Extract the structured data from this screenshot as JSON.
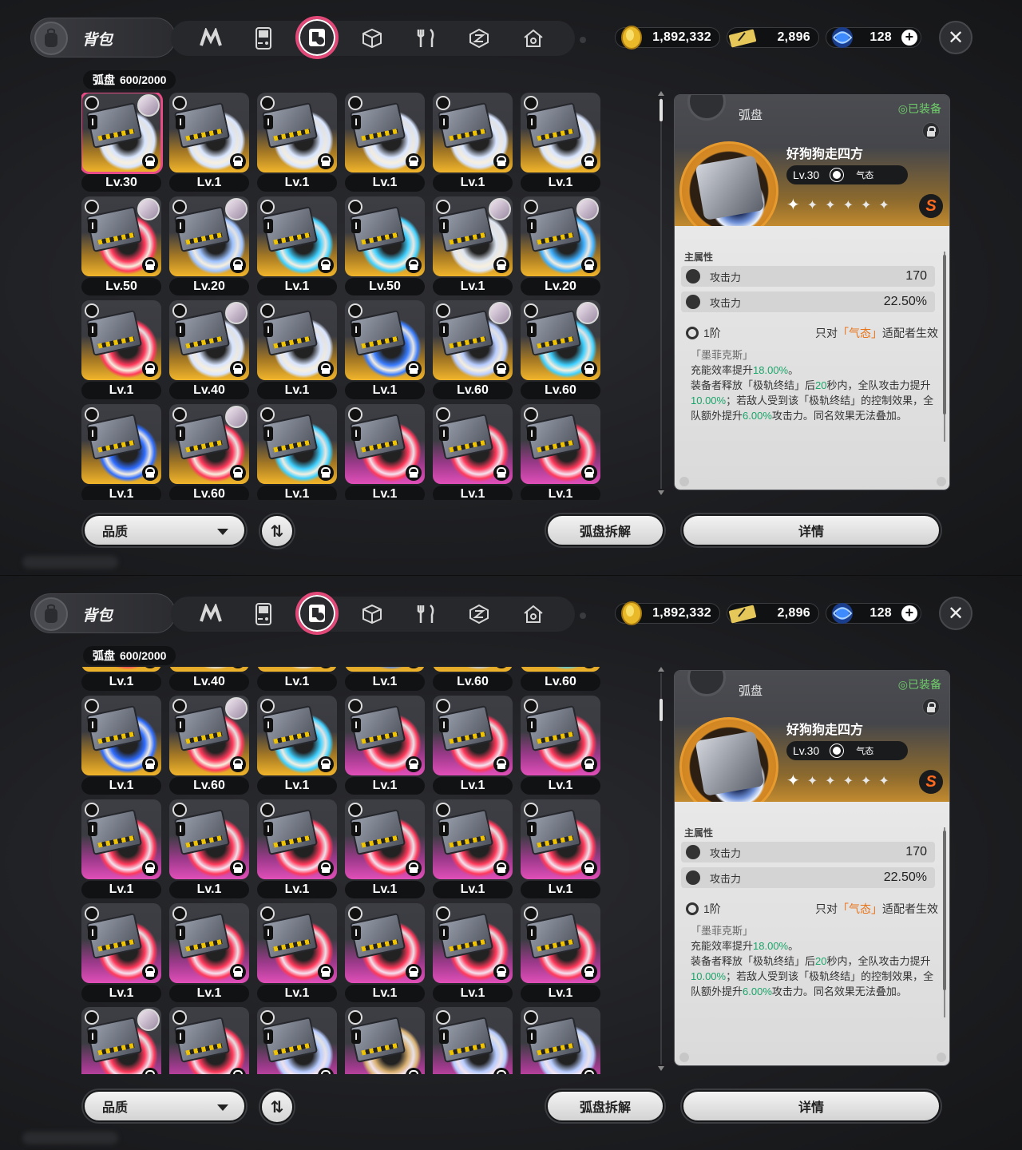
{
  "top": {
    "title": "背包",
    "tabs": [
      {
        "icon": "zenless-logo-icon"
      },
      {
        "icon": "gameboy-icon"
      },
      {
        "icon": "disc-book-icon",
        "active": true
      },
      {
        "icon": "cube-icon"
      },
      {
        "icon": "fork-knife-icon"
      },
      {
        "icon": "emblem-icon"
      },
      {
        "icon": "home-icon"
      }
    ],
    "currencies": [
      {
        "icon": "gold-coin-icon",
        "value": "1,892,332"
      },
      {
        "icon": "ticket-icon",
        "value": "2,896"
      },
      {
        "icon": "battery-icon",
        "value": "128"
      }
    ],
    "close_label": "✕"
  },
  "counter": {
    "label": "弧盘",
    "value": "600/2000"
  },
  "colors": {
    "accent": "#e74c86",
    "gold": "#f2b52b",
    "pink": "#e14fb8",
    "green": "#1ca56a",
    "orange": "#e8741a"
  },
  "panel1": {
    "items": [
      {
        "level": "Lv.30",
        "rarity": "gold",
        "avatar": true,
        "selected": true,
        "ring": "#d9e6ff"
      },
      {
        "level": "Lv.1",
        "rarity": "gold",
        "avatar": false,
        "ring": "#d9e6ff"
      },
      {
        "level": "Lv.1",
        "rarity": "gold",
        "avatar": false,
        "ring": "#d9e6ff"
      },
      {
        "level": "Lv.1",
        "rarity": "gold",
        "avatar": false,
        "ring": "#d9e6ff"
      },
      {
        "level": "Lv.1",
        "rarity": "gold",
        "avatar": false,
        "ring": "#d9e6ff"
      },
      {
        "level": "Lv.1",
        "rarity": "gold",
        "avatar": false,
        "ring": "#d9e6ff"
      },
      {
        "level": "Lv.50",
        "rarity": "gold",
        "avatar": true,
        "ring": "#ff3a5c"
      },
      {
        "level": "Lv.20",
        "rarity": "gold",
        "avatar": true,
        "ring": "#9ec3ff"
      },
      {
        "level": "Lv.1",
        "rarity": "gold",
        "avatar": false,
        "ring": "#3fd0ff"
      },
      {
        "level": "Lv.50",
        "rarity": "gold",
        "avatar": false,
        "ring": "#3fd0ff"
      },
      {
        "level": "Lv.1",
        "rarity": "gold",
        "avatar": true,
        "ring": "#dfe6f0"
      },
      {
        "level": "Lv.20",
        "rarity": "gold",
        "avatar": true,
        "ring": "#3fb0ff"
      },
      {
        "level": "Lv.1",
        "rarity": "gold",
        "avatar": false,
        "ring": "#ff3a5c"
      },
      {
        "level": "Lv.40",
        "rarity": "gold",
        "avatar": true,
        "ring": "#d9e6ff"
      },
      {
        "level": "Lv.1",
        "rarity": "gold",
        "avatar": false,
        "ring": "#d9e6ff"
      },
      {
        "level": "Lv.1",
        "rarity": "gold",
        "avatar": false,
        "ring": "#3a7dff"
      },
      {
        "level": "Lv.60",
        "rarity": "gold",
        "avatar": true,
        "ring": "#b7ccff"
      },
      {
        "level": "Lv.60",
        "rarity": "gold",
        "avatar": true,
        "ring": "#3fd0ff"
      },
      {
        "level": "Lv.1",
        "rarity": "gold",
        "avatar": false,
        "ring": "#2f6dff"
      },
      {
        "level": "Lv.60",
        "rarity": "gold",
        "avatar": true,
        "ring": "#ff3a5c"
      },
      {
        "level": "Lv.1",
        "rarity": "gold",
        "avatar": false,
        "ring": "#3fd0ff"
      },
      {
        "level": "Lv.1",
        "rarity": "pink",
        "avatar": false,
        "ring": "#ff3a5c"
      },
      {
        "level": "Lv.1",
        "rarity": "pink",
        "avatar": false,
        "ring": "#ff3a5c"
      },
      {
        "level": "Lv.1",
        "rarity": "pink",
        "avatar": false,
        "ring": "#ff3a5c"
      }
    ]
  },
  "panel2": {
    "items": [
      {
        "level": "Lv.1",
        "rarity": "gold",
        "avatar": false,
        "ring": "#ff3a5c"
      },
      {
        "level": "Lv.40",
        "rarity": "gold",
        "avatar": false,
        "ring": "#d9e6ff"
      },
      {
        "level": "Lv.1",
        "rarity": "gold",
        "avatar": false,
        "ring": "#d9e6ff"
      },
      {
        "level": "Lv.1",
        "rarity": "gold",
        "avatar": false,
        "ring": "#3a7dff"
      },
      {
        "level": "Lv.60",
        "rarity": "gold",
        "avatar": false,
        "ring": "#b7ccff"
      },
      {
        "level": "Lv.60",
        "rarity": "gold",
        "avatar": false,
        "ring": "#3fd0ff"
      },
      {
        "level": "Lv.1",
        "rarity": "gold",
        "avatar": false,
        "ring": "#2f6dff"
      },
      {
        "level": "Lv.60",
        "rarity": "gold",
        "avatar": true,
        "ring": "#ff3a5c"
      },
      {
        "level": "Lv.1",
        "rarity": "gold",
        "avatar": false,
        "ring": "#3fd0ff"
      },
      {
        "level": "Lv.1",
        "rarity": "pink",
        "avatar": false,
        "ring": "#ff3a5c"
      },
      {
        "level": "Lv.1",
        "rarity": "pink",
        "avatar": false,
        "ring": "#ff3a5c"
      },
      {
        "level": "Lv.1",
        "rarity": "pink",
        "avatar": false,
        "ring": "#ff3a5c"
      },
      {
        "level": "Lv.1",
        "rarity": "pink",
        "avatar": false,
        "ring": "#ff3a5c"
      },
      {
        "level": "Lv.1",
        "rarity": "pink",
        "avatar": false,
        "ring": "#ff3a5c"
      },
      {
        "level": "Lv.1",
        "rarity": "pink",
        "avatar": false,
        "ring": "#ff3a5c"
      },
      {
        "level": "Lv.1",
        "rarity": "pink",
        "avatar": false,
        "ring": "#ff3a5c"
      },
      {
        "level": "Lv.1",
        "rarity": "pink",
        "avatar": false,
        "ring": "#ff3a5c"
      },
      {
        "level": "Lv.1",
        "rarity": "pink",
        "avatar": false,
        "ring": "#ff3a5c"
      },
      {
        "level": "Lv.1",
        "rarity": "pink",
        "avatar": false,
        "ring": "#ff3a5c"
      },
      {
        "level": "Lv.1",
        "rarity": "pink",
        "avatar": false,
        "ring": "#ff3a5c"
      },
      {
        "level": "Lv.1",
        "rarity": "pink",
        "avatar": false,
        "ring": "#ff3a5c"
      },
      {
        "level": "Lv.1",
        "rarity": "pink",
        "avatar": false,
        "ring": "#ff3a5c"
      },
      {
        "level": "Lv.1",
        "rarity": "pink",
        "avatar": false,
        "ring": "#ff3a5c"
      },
      {
        "level": "Lv.1",
        "rarity": "pink",
        "avatar": false,
        "ring": "#ff3a5c"
      },
      {
        "level": "",
        "rarity": "pink",
        "avatar": true,
        "ring": "#ff3a5c"
      },
      {
        "level": "",
        "rarity": "pink",
        "avatar": false,
        "ring": "#ff3a5c"
      },
      {
        "level": "",
        "rarity": "pink",
        "avatar": false,
        "ring": "#b7ccff"
      },
      {
        "level": "",
        "rarity": "pink",
        "avatar": false,
        "ring": "#d9b070"
      },
      {
        "level": "",
        "rarity": "pink",
        "avatar": false,
        "ring": "#b7ccff"
      },
      {
        "level": "",
        "rarity": "pink",
        "avatar": false,
        "ring": "#b7ccff"
      }
    ]
  },
  "detail": {
    "type_label": "弧盘",
    "equipped": "◎已装备",
    "name": "好狗狗走四方",
    "level": "Lv.30",
    "tag": "气态",
    "rank": "S",
    "stars": [
      "✦",
      "✦",
      "✦",
      "✦",
      "✦",
      "✦"
    ],
    "main_title": "主属性",
    "stats": [
      {
        "name": "攻击力",
        "value": "170"
      },
      {
        "name": "攻击力",
        "value": "22.50%"
      }
    ],
    "set_tier": "1阶",
    "set_req_pre": "只对",
    "set_req_hl": "「气态」",
    "set_req_post": "适配者生效",
    "set_name": "「墨菲克斯」",
    "desc": {
      "l1_a": "充能效率提升",
      "l1_b": "18.00%",
      "l1_c": "。",
      "l2_a": "装备者释放「极轨终结」后",
      "l2_b": "20",
      "l2_c": "秒内，全队攻击力提升",
      "l2_d": "10.00%",
      "l2_e": "；若敌人受到该「极轨终结」的控制效果，全队额外提升",
      "l2_f": "6.00%",
      "l2_g": "攻击力。同名效果无法叠加。"
    }
  },
  "buttons": {
    "quality": "品质",
    "sort": "⇅",
    "dismantle": "弧盘拆解",
    "details": "详情"
  }
}
